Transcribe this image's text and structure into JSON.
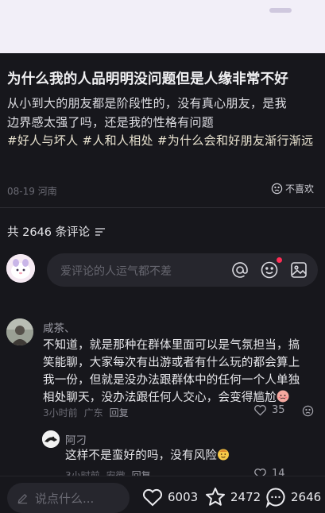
{
  "post": {
    "title": "为什么我的人品明明没问题但是人缘非常不好",
    "body_line1": "从小到大的朋友都是阶段性的，没有真心朋友，是我",
    "body_line2": "边界感太强了吗，还是我的性格有问题",
    "tags": [
      "#好人与坏人",
      "#人和人相处",
      "#为什么会和好朋友渐行渐远"
    ],
    "date": "08-19",
    "location": "河南",
    "dislike_label": "不喜欢"
  },
  "comments_header": {
    "label": "共 2646 条评论"
  },
  "comment_input": {
    "placeholder": "爱评论的人运气都不差"
  },
  "comments": [
    {
      "user": "咸茶、",
      "lines": [
        "不知道，就是那种在群体里面可以是气氛担当，搞",
        "笑能聊，大家每次有出游或者有什么玩的都会算上",
        "我一份，但就是没办法跟群体中的任何一个人单独",
        "相处聊天，没办法跟任何人交心，会变得尴尬"
      ],
      "time": "3小时前",
      "location": "广东",
      "reply_label": "回复",
      "likes": "35"
    },
    {
      "user": "阿刁",
      "text": "这样不是蛮好的吗，没有风险",
      "time": "3小时前",
      "location": "安徽",
      "reply_label": "回复",
      "likes": "14"
    }
  ],
  "bottom_bar": {
    "placeholder": "说点什么...",
    "likes": "6003",
    "stars": "2472",
    "comments": "2646"
  },
  "colors": {
    "background": "#17171c",
    "accent_red": "#ff2d55",
    "tag_text": "#e8e2cf"
  }
}
